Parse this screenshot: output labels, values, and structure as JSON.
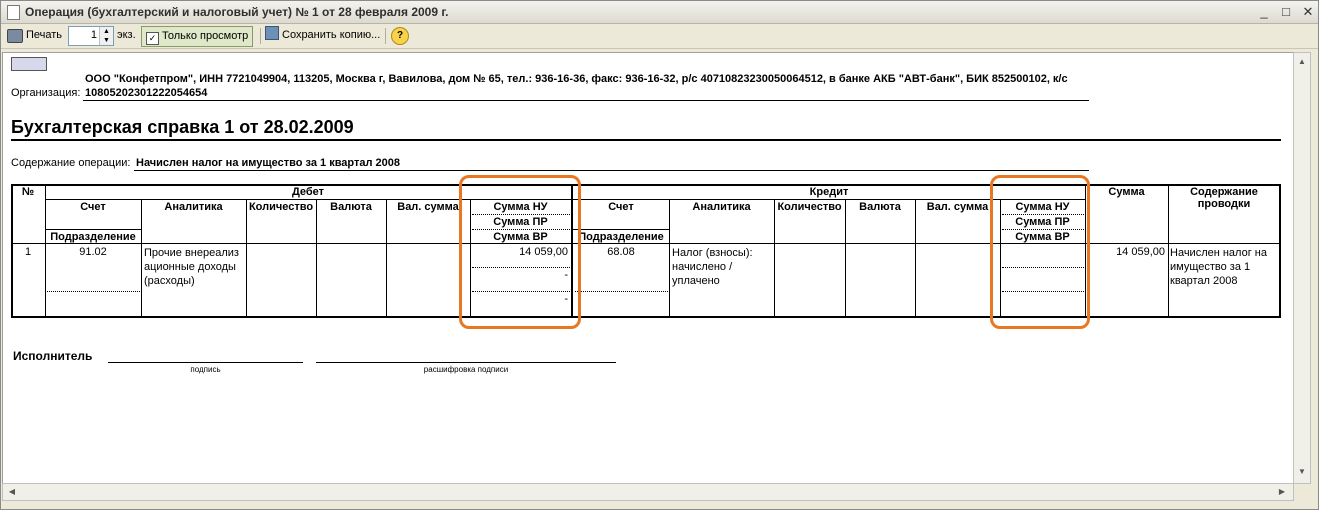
{
  "window": {
    "title": "Операция (бухгалтерский и налоговый учет) № 1 от 28 февраля 2009 г.",
    "buttons": {
      "minimize": "_",
      "maximize": "□",
      "close": "✕"
    }
  },
  "toolbar": {
    "print_label": "Печать",
    "copies_value": "1",
    "copies_unit": "экз.",
    "view_only_label": "Только просмотр",
    "save_copy_label": "Сохранить копию...",
    "help_label": "?"
  },
  "document": {
    "org_details": "ООО \"Конфетпром\", ИНН 7721049904, 113205, Москва г, Вавилова, дом № 65, тел.: 936-16-36, факс: 936-16-32, р/с 40710823230050064512, в банке АКБ \"АВТ-банк\", БИК 852500102, к/с",
    "org_label": "Организация:",
    "org_account": "10805202301222054654",
    "heading": "Бухгалтерская справка 1 от 28.02.2009",
    "operation_label": "Содержание операции:",
    "operation_value": "Начислен налог на имущество за 1 квартал 2008",
    "table": {
      "col_no": "№",
      "debit": "Дебет",
      "credit": "Кредит",
      "account": "Счет",
      "division": "Подразделение",
      "analytics": "Аналитика",
      "quantity": "Количество",
      "currency": "Валюта",
      "cur_sum": "Вал. сумма",
      "sum_nu": "Сумма НУ",
      "sum_pr": "Сумма ПР",
      "sum_vr": "Сумма ВР",
      "sum": "Сумма",
      "content": "Содержание проводки",
      "row": {
        "no": "1",
        "debit_account": "91.02",
        "debit_analytics": "Прочие внереализационные доходы (расходы)",
        "debit_nu": "14 059,00",
        "debit_pr": "-",
        "debit_vr": "-",
        "credit_account": "68.08",
        "credit_analytics": "Налог (взносы): начислено / уплачено",
        "sum": "14 059,00",
        "content": "Начислен налог на имущество за 1 квартал 2008"
      }
    },
    "executor_label": "Исполнитель",
    "signature_caption": "подпись",
    "decoding_caption": "расшифровка подписи"
  },
  "colors": {
    "highlight": "#e87722"
  }
}
